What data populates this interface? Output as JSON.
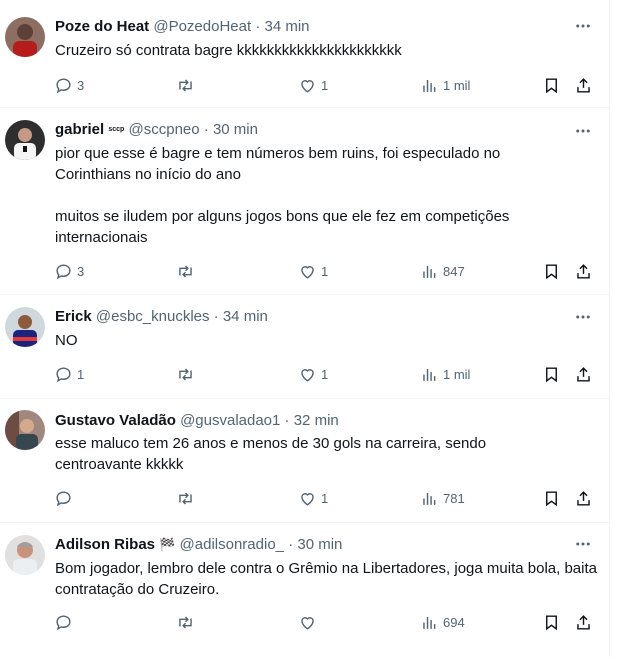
{
  "tweets": [
    {
      "name": "Poze do Heat",
      "badge": "",
      "handle": "@PozedoHeat",
      "time": "34 min",
      "text": [
        "Cruzeiro só contrata bagre kkkkkkkkkkkkkkkkkkkkkk"
      ],
      "replies": "3",
      "retweets": "",
      "likes": "1",
      "views": "1 mil"
    },
    {
      "name": "gabriel",
      "badge": "sccp",
      "handle": "@sccpneo",
      "time": "30 min",
      "text": [
        "pior que esse é bagre e tem números bem ruins, foi especulado no Corinthians no início do ano",
        "muitos se iludem por alguns jogos bons que ele fez em competições internacionais"
      ],
      "replies": "3",
      "retweets": "",
      "likes": "1",
      "views": "847"
    },
    {
      "name": "Erick",
      "badge": "",
      "handle": "@esbc_knuckles",
      "time": "34 min",
      "text": [
        "NO"
      ],
      "replies": "1",
      "retweets": "",
      "likes": "1",
      "views": "1 mil"
    },
    {
      "name": "Gustavo Valadão",
      "badge": "",
      "handle": "@gusvaladao1",
      "time": "32 min",
      "text": [
        "esse maluco tem 26 anos e menos de 30 gols na carreira, sendo centroavante kkkkk"
      ],
      "replies": "",
      "retweets": "",
      "likes": "1",
      "views": "781"
    },
    {
      "name": "Adilson Ribas",
      "badge": "🏁",
      "handle": "@adilsonradio_",
      "time": "30 min",
      "text": [
        "Bom jogador, lembro dele contra o Grêmio na Libertadores, joga muita bola, baita contratação do Cruzeiro."
      ],
      "replies": "",
      "retweets": "",
      "likes": "",
      "views": "694"
    }
  ],
  "separator": "·",
  "colors": {
    "text": "#0f1419",
    "muted": "#536471",
    "divider": "#eff3f4"
  },
  "icons": [
    "more-icon",
    "reply-icon",
    "retweet-icon",
    "like-icon",
    "views-icon",
    "bookmark-icon",
    "share-icon"
  ]
}
